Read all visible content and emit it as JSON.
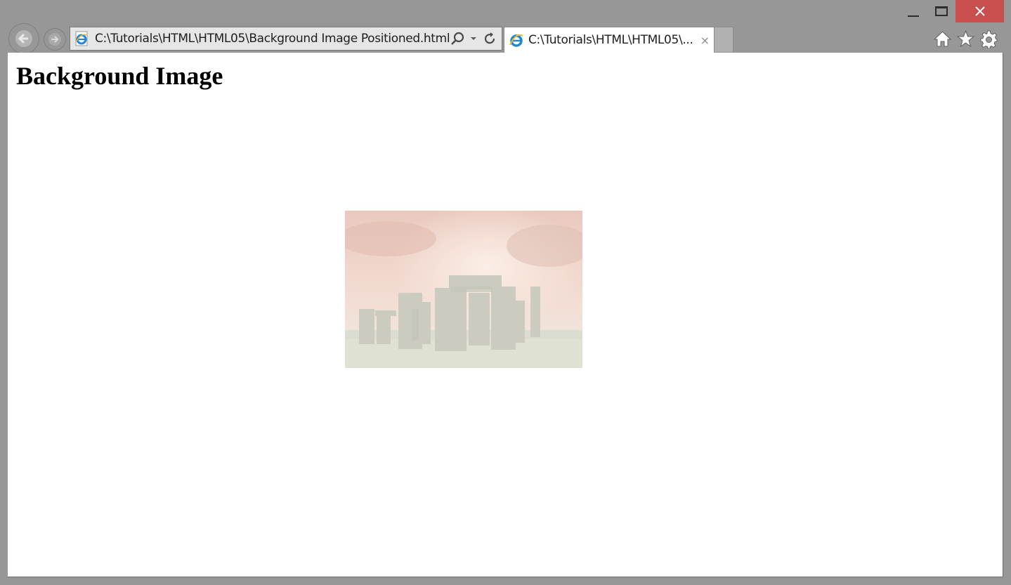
{
  "window": {
    "controls": {
      "minimize": "minimize",
      "maximize": "maximize",
      "close": "close"
    }
  },
  "navigation": {
    "back_icon": "back-arrow-icon",
    "forward_icon": "forward-arrow-icon"
  },
  "address_bar": {
    "url": "C:\\Tutorials\\HTML\\HTML05\\Background Image Positioned.html",
    "search_icon": "search-icon",
    "dropdown_icon": "chevron-down-icon",
    "refresh_icon": "refresh-icon"
  },
  "tabs": [
    {
      "title": "C:\\Tutorials\\HTML\\HTML05\\...",
      "active": true,
      "close": "×"
    }
  ],
  "toolbar": {
    "icons": [
      "home-icon",
      "favorites-star-icon",
      "settings-gear-icon"
    ]
  },
  "page": {
    "heading": "Background Image",
    "background_image": {
      "subject": "Stonehenge at sunset (faded)",
      "position": "center"
    }
  },
  "colors": {
    "close_button": "#c7504f",
    "chrome": "#979797",
    "ie_blue": "#1e88d8",
    "ie_gold": "#f3b72a"
  }
}
